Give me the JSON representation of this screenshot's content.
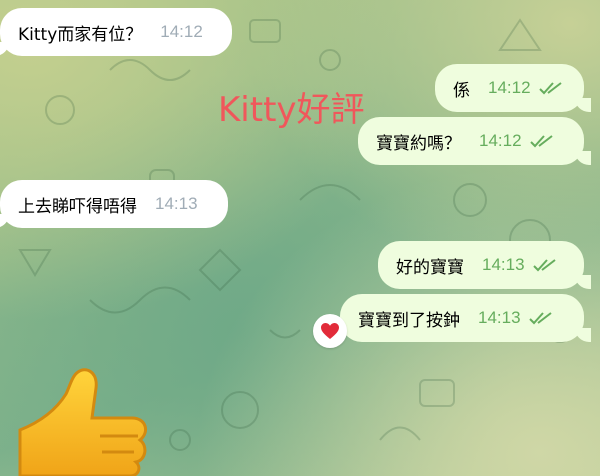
{
  "overlay": {
    "text": "Kitty好評"
  },
  "messages": [
    {
      "text": "Kitty而家有位？",
      "time": "14:12",
      "direction": "incoming"
    },
    {
      "text": "係",
      "time": "14:12",
      "direction": "outgoing",
      "status": "read"
    },
    {
      "text": "寶寶約嗎？",
      "time": "14:12",
      "direction": "outgoing",
      "status": "read"
    },
    {
      "text": "上去睇吓得唔得",
      "time": "14:13",
      "direction": "incoming"
    },
    {
      "text": "好的寶寶",
      "time": "14:13",
      "direction": "outgoing",
      "status": "read"
    },
    {
      "text": "寶寶到了按鈡",
      "time": "14:13",
      "direction": "outgoing",
      "status": "read",
      "reaction": "❤️"
    }
  ],
  "sticker": {
    "icon": "thumbs-up-sticker"
  },
  "colors": {
    "incoming_bubble": "#ffffff",
    "outgoing_bubble": "#effdde",
    "overlay_text": "#f0575b",
    "read_ticks": "#66ad5d"
  }
}
